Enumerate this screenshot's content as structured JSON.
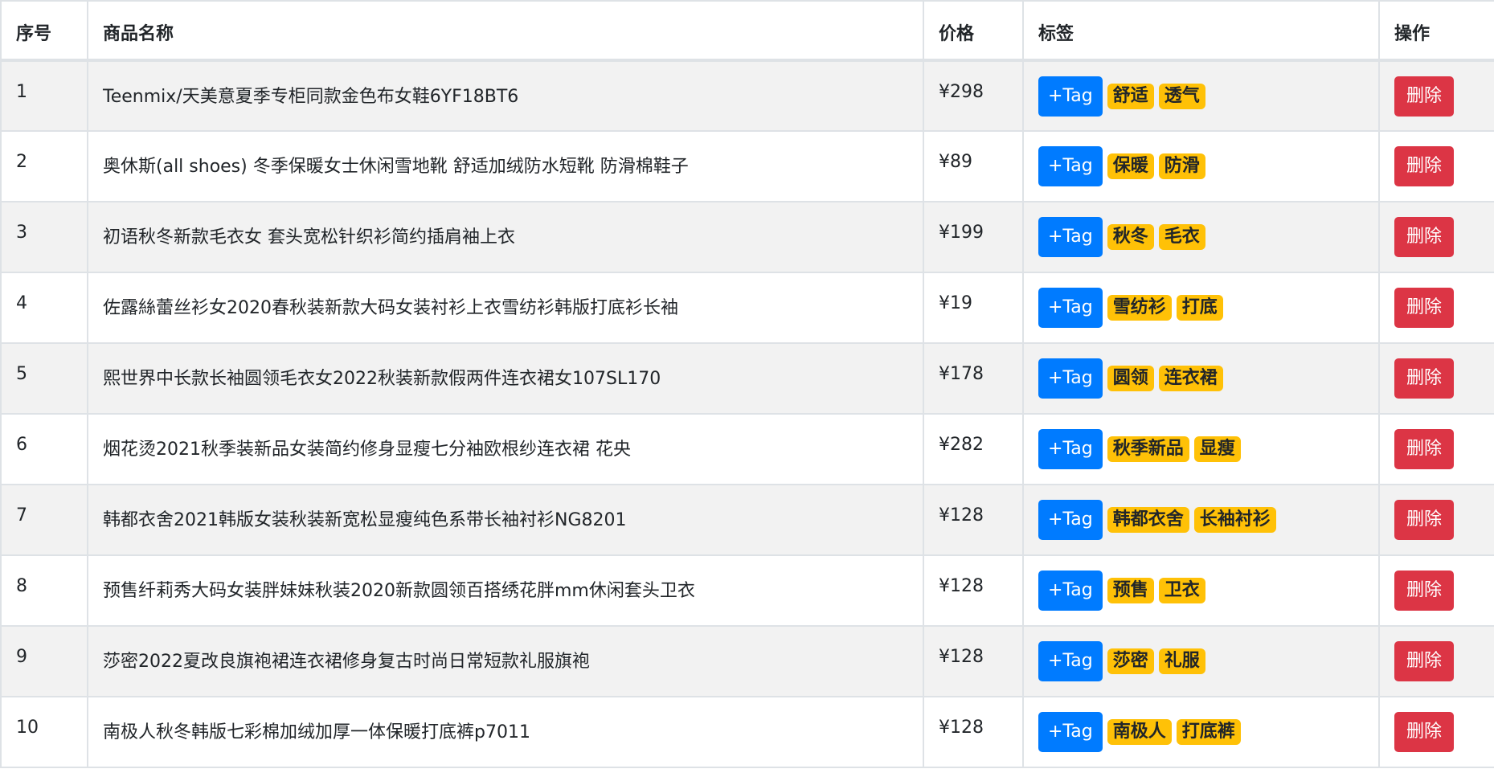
{
  "table": {
    "headers": {
      "index": "序号",
      "name": "商品名称",
      "price": "价格",
      "tags": "标签",
      "actions": "操作"
    },
    "add_tag_label": "+Tag",
    "delete_label": "删除",
    "rows": [
      {
        "index": "1",
        "name": "Teenmix/天美意夏季专柜同款金色布女鞋6YF18BT6",
        "price": "¥298",
        "tags": [
          "舒适",
          "透气"
        ]
      },
      {
        "index": "2",
        "name": "奥休斯(all shoes) 冬季保暖女士休闲雪地靴 舒适加绒防水短靴 防滑棉鞋子",
        "price": "¥89",
        "tags": [
          "保暖",
          "防滑"
        ]
      },
      {
        "index": "3",
        "name": "初语秋冬新款毛衣女 套头宽松针织衫简约插肩袖上衣",
        "price": "¥199",
        "tags": [
          "秋冬",
          "毛衣"
        ]
      },
      {
        "index": "4",
        "name": "佐露絲蕾丝衫女2020春秋装新款大码女装衬衫上衣雪纺衫韩版打底衫长袖",
        "price": "¥19",
        "tags": [
          "雪纺衫",
          "打底"
        ]
      },
      {
        "index": "5",
        "name": "熙世界中长款长袖圆领毛衣女2022秋装新款假两件连衣裙女107SL170",
        "price": "¥178",
        "tags": [
          "圆领",
          "连衣裙"
        ]
      },
      {
        "index": "6",
        "name": "烟花烫2021秋季装新品女装简约修身显瘦七分袖欧根纱连衣裙 花央",
        "price": "¥282",
        "tags": [
          "秋季新品",
          "显瘦"
        ]
      },
      {
        "index": "7",
        "name": "韩都衣舍2021韩版女装秋装新宽松显瘦纯色系带长袖衬衫NG8201",
        "price": "¥128",
        "tags": [
          "韩都衣舍",
          "长袖衬衫"
        ]
      },
      {
        "index": "8",
        "name": "预售纤莉秀大码女装胖妹妹秋装2020新款圆领百搭绣花胖mm休闲套头卫衣",
        "price": "¥128",
        "tags": [
          "预售",
          "卫衣"
        ]
      },
      {
        "index": "9",
        "name": "莎密2022夏改良旗袍裙连衣裙修身复古时尚日常短款礼服旗袍",
        "price": "¥128",
        "tags": [
          "莎密",
          "礼服"
        ]
      },
      {
        "index": "10",
        "name": "南极人秋冬韩版七彩棉加绒加厚一体保暖打底裤p7011",
        "price": "¥128",
        "tags": [
          "南极人",
          "打底裤"
        ]
      }
    ]
  },
  "colors": {
    "add_tag_button": "#007bff",
    "tag_badge": "#ffc107",
    "delete_button": "#dc3545",
    "striped_row": "#f2f2f2",
    "border": "#dee2e6"
  }
}
